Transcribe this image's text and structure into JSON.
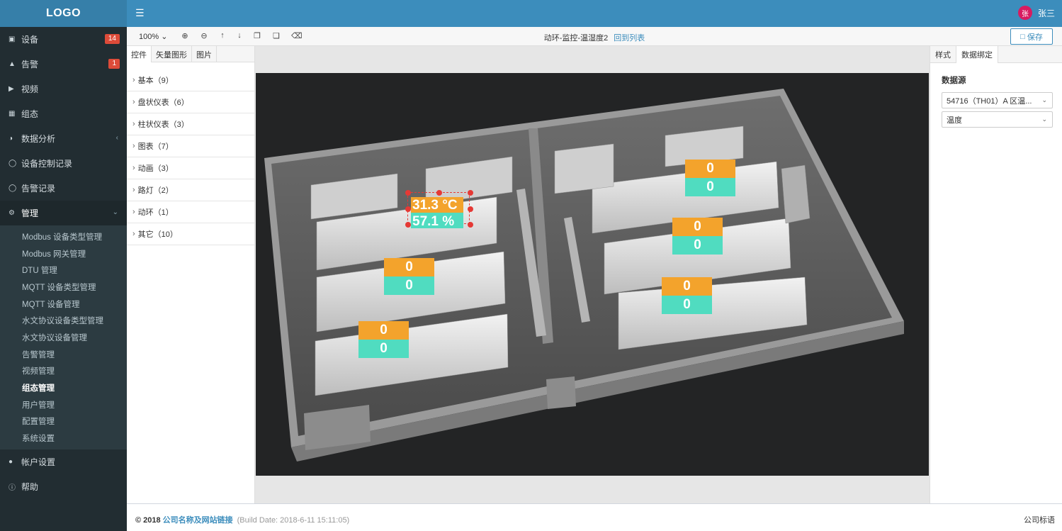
{
  "sidebar": {
    "logo": "LOGO",
    "items": [
      {
        "label": "设备",
        "icon": "database-icon",
        "badge": "14"
      },
      {
        "label": "告警",
        "icon": "bell-icon",
        "badge": "1"
      },
      {
        "label": "视频",
        "icon": "video-camera-icon"
      },
      {
        "label": "组态",
        "icon": "grid-icon"
      },
      {
        "label": "数据分析",
        "icon": "pie-chart-icon"
      },
      {
        "label": "设备控制记录",
        "icon": "clock-icon"
      },
      {
        "label": "告警记录",
        "icon": "clock-icon"
      },
      {
        "label": "管理",
        "icon": "gear-icon"
      }
    ],
    "submenu": [
      "Modbus 设备类型管理",
      "Modbus 网关管理",
      "DTU 管理",
      "MQTT 设备类型管理",
      "MQTT 设备管理",
      "水文协议设备类型管理",
      "水文协议设备管理",
      "告警管理",
      "视频管理",
      "组态管理",
      "用户管理",
      "配置管理",
      "系统设置"
    ],
    "bottom_items": [
      {
        "label": "帐户设置",
        "icon": "user-icon"
      },
      {
        "label": "帮助",
        "icon": "info-icon"
      }
    ]
  },
  "header": {
    "avatar_letter": "张",
    "username": "张三"
  },
  "toolbar": {
    "zoom": "100%",
    "title": "动环-监控-温湿度2",
    "back_link": "回到列表",
    "save_label": "保存"
  },
  "palette": {
    "tabs": [
      "控件",
      "矢量图形",
      "图片"
    ],
    "items": [
      "基本（9）",
      "盘状仪表（6）",
      "柱状仪表（3）",
      "图表（7）",
      "动画（3）",
      "路灯（2）",
      "动环（1）",
      "其它（10）"
    ]
  },
  "canvas": {
    "selected_widget": {
      "temperature": "31.3 °C",
      "humidity": "57.1 %"
    },
    "widgets": [
      {
        "temp": "0",
        "hum": "0"
      },
      {
        "temp": "0",
        "hum": "0"
      },
      {
        "temp": "0",
        "hum": "0"
      },
      {
        "temp": "0",
        "hum": "0"
      },
      {
        "temp": "0",
        "hum": "0"
      }
    ]
  },
  "right_panel": {
    "tabs": [
      "样式",
      "数据绑定"
    ],
    "datasource_label": "数据源",
    "datasource_value": "54716（TH01）A 区温...",
    "field_value": "温度"
  },
  "footer": {
    "copyright": "© 2018",
    "company": "公司名称及网站链接",
    "build": "(Build Date: 2018-6-11 15:11:05)",
    "slogan": "公司标语"
  },
  "colors": {
    "sidebar_bg": "#222d32",
    "header_bg": "#3c8dbc",
    "temp_orange": "#f3a32c",
    "hum_teal": "#50dcc0",
    "badge_red": "#dd4b39"
  }
}
